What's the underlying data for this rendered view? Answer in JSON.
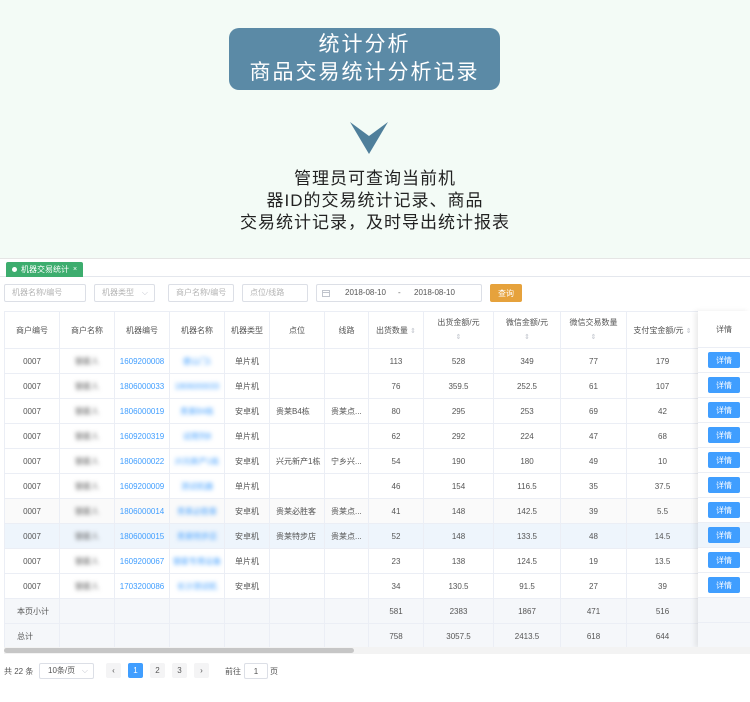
{
  "hero": {
    "title_line1": "统计分析",
    "title_line2": "商品交易统计分析记录",
    "desc_line1": "管理员可查询当前机",
    "desc_line2": "器ID的交易统计记录、商品",
    "desc_line3": "交易统计记录，及时导出统计报表"
  },
  "tab": {
    "label": "机器交易统计",
    "close": "×"
  },
  "filters": {
    "machine_name_placeholder": "机器名称/编号",
    "machine_type_placeholder": "机器类型",
    "merchant_placeholder": "商户名称/编号",
    "point_placeholder": "点位/线路",
    "date_start": "2018-08-10",
    "date_sep": "-",
    "date_end": "2018-08-10",
    "query_label": "查询"
  },
  "table": {
    "headers": {
      "merchant_no": "商户编号",
      "merchant_name": "商户名称",
      "machine_no": "机器编号",
      "machine_name": "机器名称",
      "machine_type": "机器类型",
      "point": "点位",
      "route": "线路",
      "out_qty": "出货数量",
      "out_amount_1": "出货金额/元",
      "wechat_amount_1": "微信金额/元",
      "wechat_qty_1": "微信交易数量",
      "alipay_amount_1": "支付宝金额/元",
      "detail": "详情"
    },
    "rows": [
      {
        "merchant_no": "0007",
        "merchant_name": "钢星人",
        "machine_no": "1609200008",
        "machine_name": "便山门1",
        "type": "单片机",
        "point": "",
        "route": "",
        "out_qty": "113",
        "out_amount": "528",
        "wechat_amount": "349",
        "wechat_qty": "77",
        "alipay": "179"
      },
      {
        "merchant_no": "0007",
        "merchant_name": "钢星人",
        "machine_no": "1806000033",
        "machine_name": "1806000033",
        "type": "单片机",
        "point": "",
        "route": "",
        "out_qty": "76",
        "out_amount": "359.5",
        "wechat_amount": "252.5",
        "wechat_qty": "61",
        "alipay": "107"
      },
      {
        "merchant_no": "0007",
        "merchant_name": "钢星人",
        "machine_no": "1806000019",
        "machine_name": "贵莱B4栋",
        "type": "安卓机",
        "point": "贵莱B4栋",
        "route": "贵莱点...",
        "out_qty": "80",
        "out_amount": "295",
        "wechat_amount": "253",
        "wechat_qty": "69",
        "alipay": "42"
      },
      {
        "merchant_no": "0007",
        "merchant_name": "钢星人",
        "machine_no": "1609200319",
        "machine_name": "试用列8",
        "type": "单片机",
        "point": "",
        "route": "",
        "out_qty": "62",
        "out_amount": "292",
        "wechat_amount": "224",
        "wechat_qty": "47",
        "alipay": "68"
      },
      {
        "merchant_no": "0007",
        "merchant_name": "钢星人",
        "machine_no": "1806000022",
        "machine_name": "兴元新产1栋",
        "type": "安卓机",
        "point": "兴元新产1栋",
        "route": "宁乡兴...",
        "out_qty": "54",
        "out_amount": "190",
        "wechat_amount": "180",
        "wechat_qty": "49",
        "alipay": "10"
      },
      {
        "merchant_no": "0007",
        "merchant_name": "钢星人",
        "machine_no": "1609200009",
        "machine_name": "测试机器",
        "type": "单片机",
        "point": "",
        "route": "",
        "out_qty": "46",
        "out_amount": "154",
        "wechat_amount": "116.5",
        "wechat_qty": "35",
        "alipay": "37.5"
      },
      {
        "merchant_no": "0007",
        "merchant_name": "钢星人",
        "machine_no": "1806000014",
        "machine_name": "贵莱必胜客",
        "type": "安卓机",
        "point": "贵莱必胜客",
        "route": "贵莱点...",
        "out_qty": "41",
        "out_amount": "148",
        "wechat_amount": "142.5",
        "wechat_qty": "39",
        "alipay": "5.5"
      },
      {
        "merchant_no": "0007",
        "merchant_name": "钢星人",
        "machine_no": "1806000015",
        "machine_name": "贵莱特步店",
        "type": "安卓机",
        "point": "贵莱特步店",
        "route": "贵莱点...",
        "out_qty": "52",
        "out_amount": "148",
        "wechat_amount": "133.5",
        "wechat_qty": "48",
        "alipay": "14.5"
      },
      {
        "merchant_no": "0007",
        "merchant_name": "钢星人",
        "machine_no": "1609200067",
        "machine_name": "钢星专用设备",
        "type": "单片机",
        "point": "",
        "route": "",
        "out_qty": "23",
        "out_amount": "138",
        "wechat_amount": "124.5",
        "wechat_qty": "19",
        "alipay": "13.5"
      },
      {
        "merchant_no": "0007",
        "merchant_name": "钢星人",
        "machine_no": "1703200086",
        "machine_name": "长沙测试机",
        "type": "安卓机",
        "point": "",
        "route": "",
        "out_qty": "34",
        "out_amount": "130.5",
        "wechat_amount": "91.5",
        "wechat_qty": "27",
        "alipay": "39"
      }
    ],
    "detail_label": "详情",
    "subtotal": {
      "label": "本页小计",
      "out_qty": "581",
      "out_amount": "2383",
      "wechat_amount": "1867",
      "wechat_qty": "471",
      "alipay": "516"
    },
    "total": {
      "label": "总计",
      "out_qty": "758",
      "out_amount": "3057.5",
      "wechat_amount": "2413.5",
      "wechat_qty": "618",
      "alipay": "644"
    }
  },
  "pagination": {
    "total_text": "共 22 条",
    "page_size": "10条/页",
    "prev": "‹",
    "pages": [
      "1",
      "2",
      "3"
    ],
    "next": "›",
    "goto_label": "前往",
    "goto_value": "1",
    "page_unit": "页"
  },
  "colors": {
    "accent": "#409eff",
    "tab_green": "#3dad6e",
    "query_orange": "#e6a23c",
    "hero_blue": "#5b8aa6"
  }
}
